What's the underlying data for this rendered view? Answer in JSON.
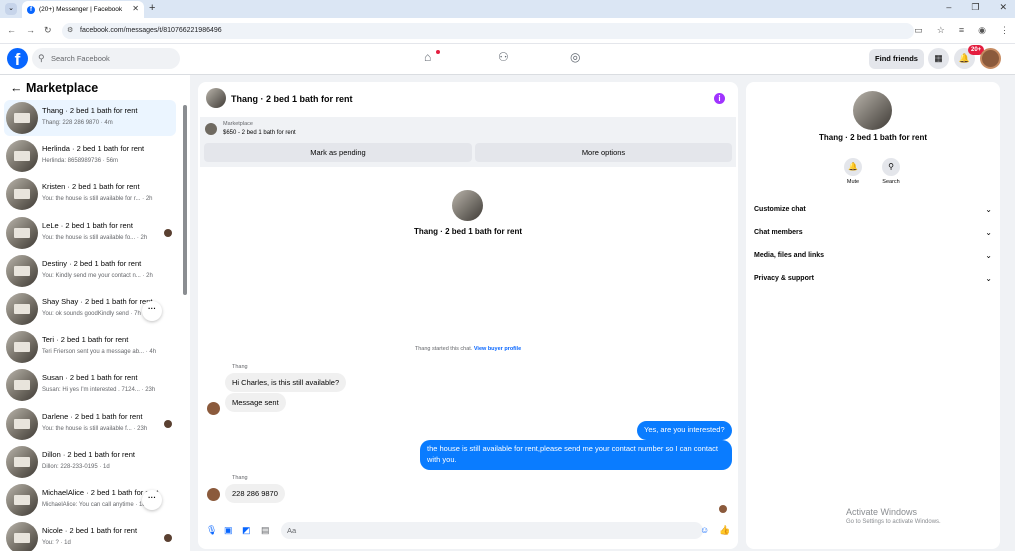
{
  "browser": {
    "tab_title": "(20+) Messenger | Facebook",
    "url": "facebook.com/messages/t/810766221986496"
  },
  "header": {
    "search_placeholder": "Search Facebook",
    "find_friends": "Find friends",
    "notif_count": "20+"
  },
  "sidebar": {
    "title": "Marketplace",
    "conversations": [
      {
        "title": "Thang · 2 bed 1 bath for rent",
        "sub": "Thang: 228 286 9870 · 4m",
        "active": true,
        "seen": false
      },
      {
        "title": "Herlinda · 2 bed 1 bath for rent",
        "sub": "Herlinda: 8658989736 · 56m",
        "active": false,
        "seen": false
      },
      {
        "title": "Kristen · 2 bed 1 bath for rent",
        "sub": "You: the house is still available for r... · 2h",
        "active": false,
        "seen": false
      },
      {
        "title": "LeLe · 2 bed 1 bath for rent",
        "sub": "You: the house is still available fo... · 2h",
        "active": false,
        "seen": true
      },
      {
        "title": "Destiny · 2 bed 1 bath for rent",
        "sub": "You: Kindly send me your contact n... · 2h",
        "active": false,
        "seen": false
      },
      {
        "title": "Shay Shay · 2 bed 1 bath for rent",
        "sub": "You: ok sounds goodKindly send · 7h",
        "active": false,
        "seen": false
      },
      {
        "title": "Teri · 2 bed 1 bath for rent",
        "sub": "Teri Frierson sent you a message ab... · 4h",
        "active": false,
        "seen": false
      },
      {
        "title": "Susan · 2 bed 1 bath for rent",
        "sub": "Susan: Hi yes I'm interested . 7124... · 23h",
        "active": false,
        "seen": false
      },
      {
        "title": "Darlene · 2 bed 1 bath for rent",
        "sub": "You: the house is still available f... · 23h",
        "active": false,
        "seen": true
      },
      {
        "title": "Dillon · 2 bed 1 bath for rent",
        "sub": "Dillon: 228-233-0195 · 1d",
        "active": false,
        "seen": false
      },
      {
        "title": "MichaelAlice · 2 bed 1 bath for rent",
        "sub": "MichaelAlice: You can call anytime · 1d",
        "active": false,
        "seen": false
      },
      {
        "title": "Nicole · 2 bed 1 bath for rent",
        "sub": "You: ? · 1d",
        "active": false,
        "seen": true
      }
    ]
  },
  "chat": {
    "title": "Thang · 2 bed 1 bath for rent",
    "marketplace_label": "Marketplace",
    "listing": "$650 - 2 bed 1 bath for rent",
    "mark_pending": "Mark as pending",
    "more_options": "More options",
    "center_name": "Thang · 2 bed 1 bath for rent",
    "started_text": "Thang started this chat.",
    "view_profile": "View buyer profile",
    "sender_name": "Thang",
    "msg1": "Hi Charles, is this still available?",
    "msg2": "Message sent",
    "out1": "Yes, are you interested?",
    "out2": "the house is still available for rent,please send me your contact number so I can contact with you.",
    "sender_name2": "Thang",
    "msg3": "228 286 9870",
    "composer_placeholder": "Aa"
  },
  "right_panel": {
    "name": "Thang · 2 bed 1 bath for rent",
    "mute": "Mute",
    "search": "Search",
    "items": [
      "Customize chat",
      "Chat members",
      "Media, files and links",
      "Privacy & support"
    ]
  },
  "watermark": {
    "line1": "Activate Windows",
    "line2": "Go to Settings to activate Windows."
  }
}
